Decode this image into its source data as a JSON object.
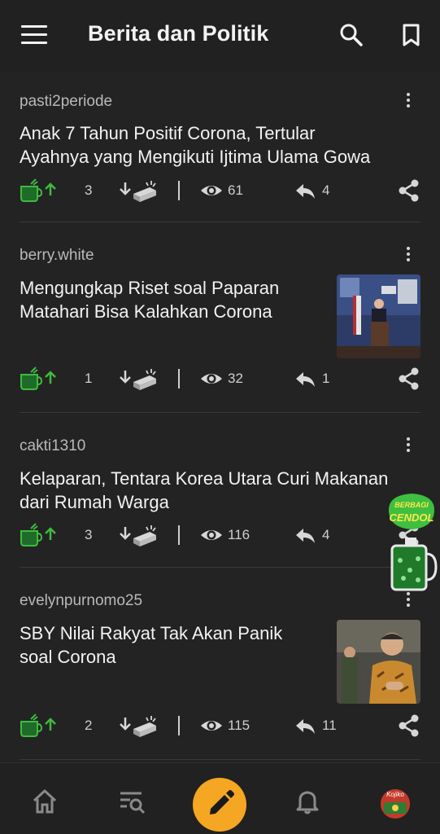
{
  "header": {
    "title": "Berita dan Politik",
    "menu_icon": "hamburger-menu-icon",
    "search_icon": "search-icon",
    "bookmark_icon": "bookmark-icon"
  },
  "posts": [
    {
      "username": "pasti2periode",
      "title_lines": [
        "Anak 7 Tahun Positif Corona, Tertular",
        "Ayahnya yang Mengikuti Ijtima Ulama Gowa"
      ],
      "has_thumbnail": false,
      "cendol_count": "3",
      "views": "61",
      "replies": "4"
    },
    {
      "username": "berry.white",
      "title_lines": [
        "Mengungkap Riset soal Paparan",
        "Matahari Bisa Kalahkan Corona"
      ],
      "has_thumbnail": true,
      "thumbnail": "press-briefing-photo",
      "cendol_count": "1",
      "views": "32",
      "replies": "1"
    },
    {
      "username": "cakti1310",
      "title_lines": [
        "Kelaparan, Tentara Korea Utara Curi Makanan",
        "dari Rumah Warga"
      ],
      "has_thumbnail": false,
      "cendol_count": "3",
      "views": "116",
      "replies": "4"
    },
    {
      "username": "evelynpurnomo25",
      "title_lines": [
        "SBY Nilai Rakyat Tak Akan Panik",
        "soal Corona"
      ],
      "has_thumbnail": true,
      "thumbnail": "politician-batik-photo",
      "cendol_count": "2",
      "views": "115",
      "replies": "11"
    }
  ],
  "floating_badge": {
    "line1": "BERBAGI",
    "line2": "CENDOL"
  },
  "bottom_nav": {
    "items": [
      "home-icon",
      "search-list-icon",
      "create-post-icon",
      "notification-bell-icon",
      "profile-avatar"
    ],
    "avatar_label": "Kojiko"
  },
  "colors": {
    "background": "#232323",
    "accent_orange": "#f5a623",
    "cendol_green": "#3dbb3d",
    "text_primary": "#f2f2f2"
  }
}
